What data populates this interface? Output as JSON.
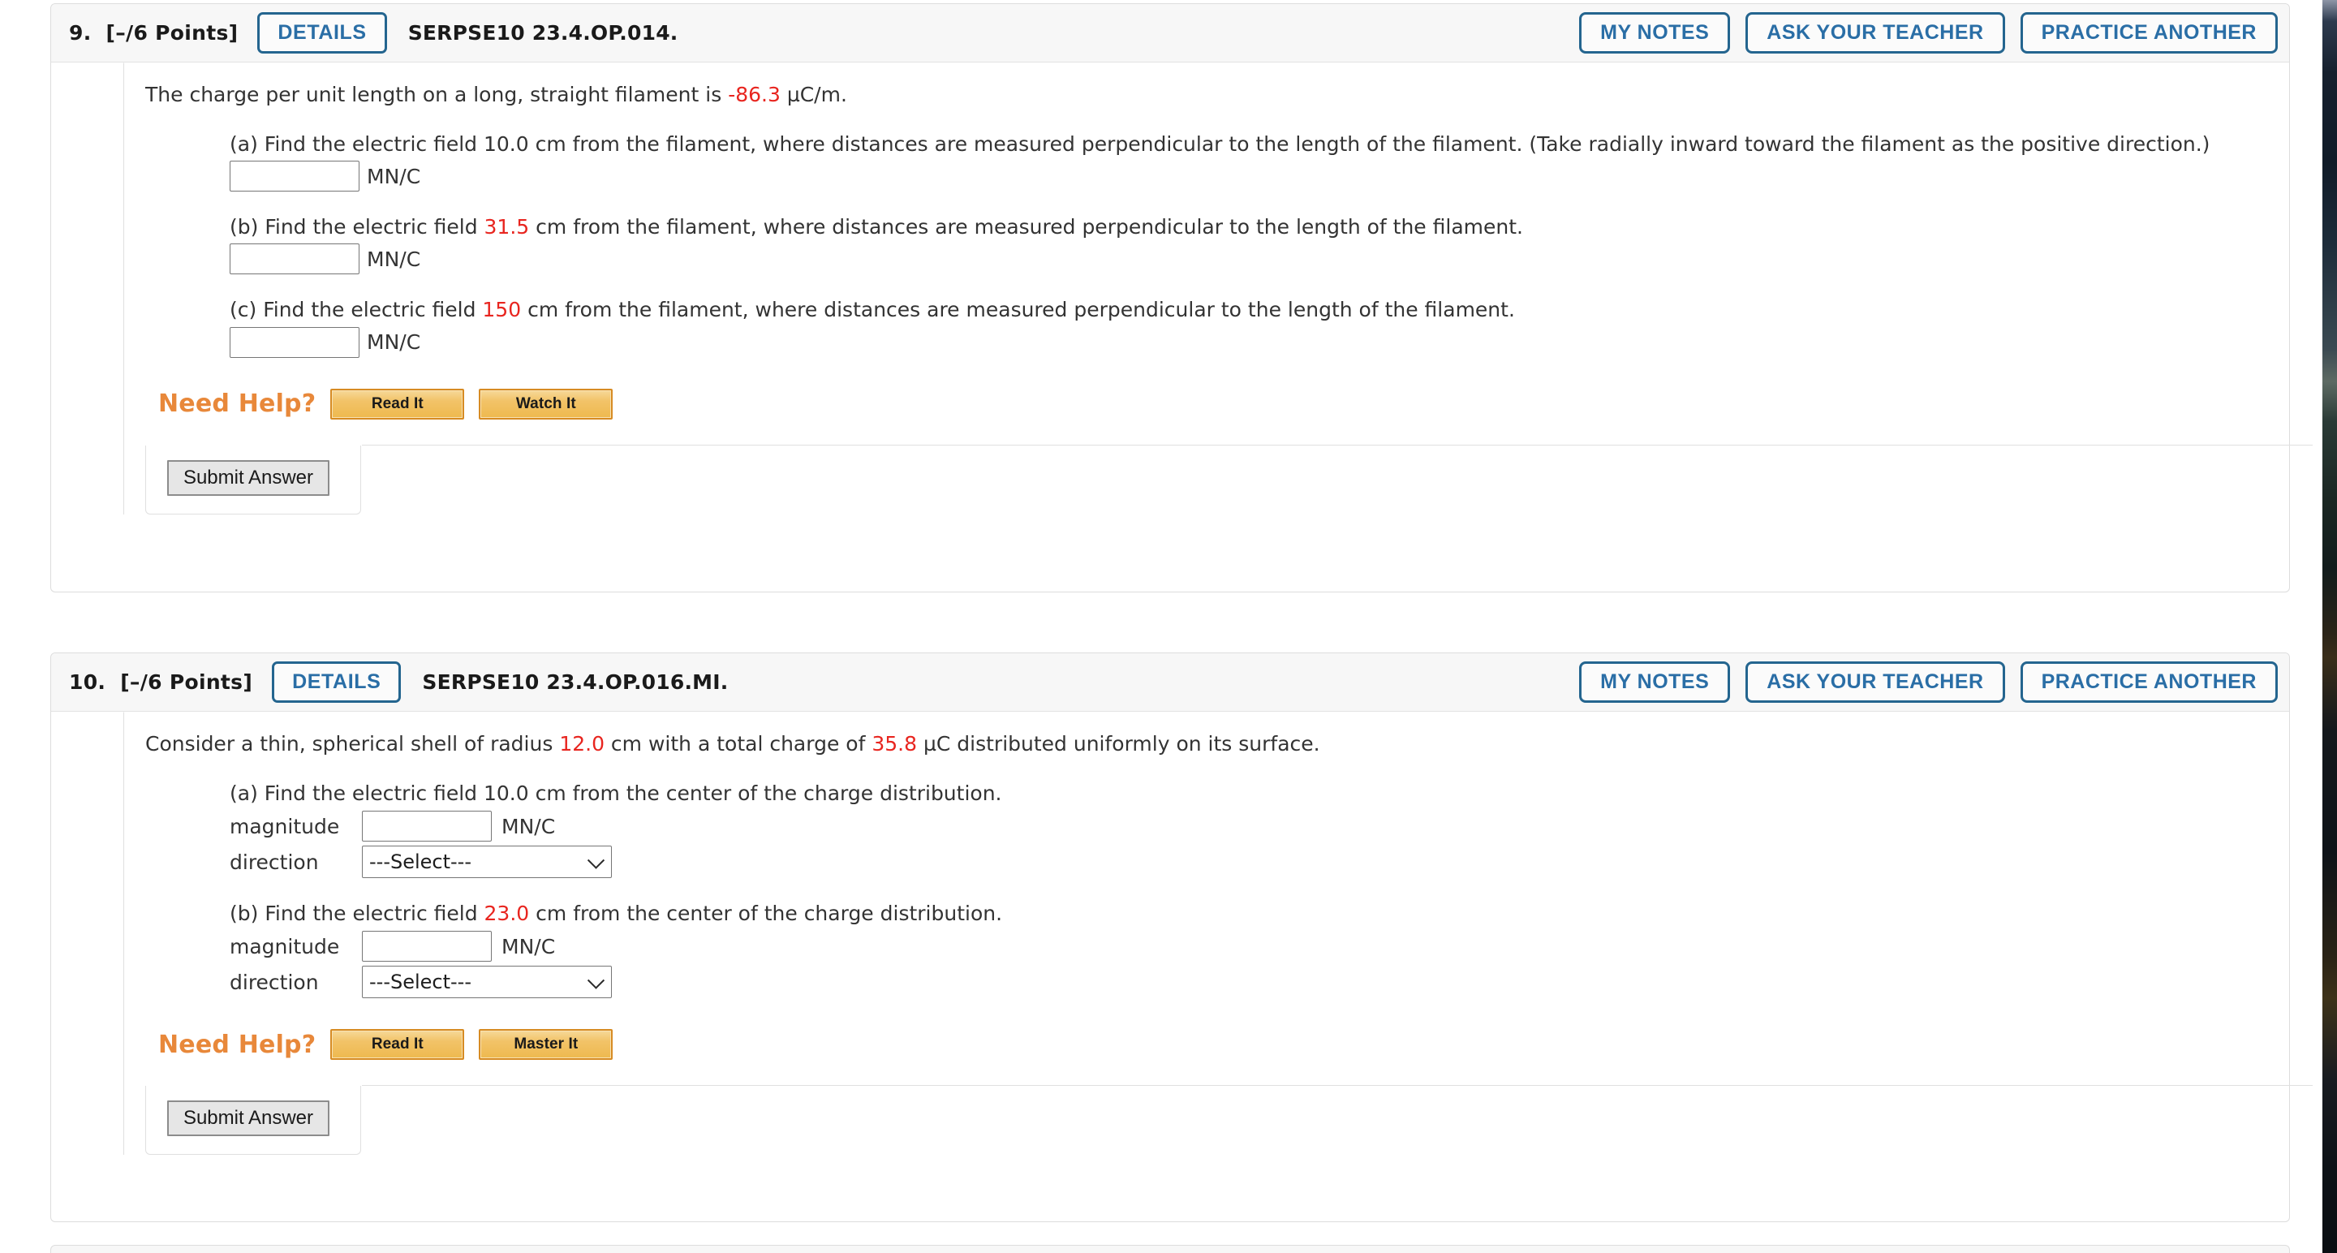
{
  "questions": [
    {
      "number": "9.",
      "points": "[–/6 Points]",
      "details_label": "DETAILS",
      "code": "SERPSE10 23.4.OP.014.",
      "actions": {
        "my_notes": "MY NOTES",
        "ask_your_teacher": "ASK YOUR TEACHER",
        "practice_another": "PRACTICE ANOTHER"
      },
      "stem": {
        "before": "The charge per unit length on a long, straight filament is ",
        "value": "-86.3",
        "after": " µC/m."
      },
      "parts": [
        {
          "label": "(a) Find the electric field 10.0 cm from the filament, where distances are measured perpendicular to the length of the filament. (Take radially inward toward the filament as the positive direction.)",
          "input_value": "",
          "unit": "MN/C"
        },
        {
          "prefix": "(b) Find the electric field ",
          "value": "31.5",
          "suffix": " cm from the filament, where distances are measured perpendicular to the length of the filament.",
          "input_value": "",
          "unit": "MN/C"
        },
        {
          "prefix": "(c) Find the electric field ",
          "value": "150",
          "suffix": " cm from the filament, where distances are measured perpendicular to the length of the filament.",
          "input_value": "",
          "unit": "MN/C"
        }
      ],
      "need_help_label": "Need Help?",
      "help_buttons": [
        "Read It",
        "Watch It"
      ],
      "submit_label": "Submit Answer"
    },
    {
      "number": "10.",
      "points": "[–/6 Points]",
      "details_label": "DETAILS",
      "code": "SERPSE10 23.4.OP.016.MI.",
      "actions": {
        "my_notes": "MY NOTES",
        "ask_your_teacher": "ASK YOUR TEACHER",
        "practice_another": "PRACTICE ANOTHER"
      },
      "stem": {
        "before": "Consider a thin, spherical shell of radius ",
        "value": "12.0",
        "mid": " cm with a total charge of ",
        "value2": "35.8",
        "after": " µC distributed uniformly on its surface."
      },
      "parts": [
        {
          "label": "(a) Find the electric field 10.0 cm from the center of the charge distribution.",
          "magnitude_label": "magnitude",
          "magnitude_value": "",
          "unit": "MN/C",
          "direction_label": "direction",
          "direction_value": "---Select---"
        },
        {
          "prefix": "(b) Find the electric field ",
          "value": "23.0",
          "suffix": " cm from the center of the charge distribution.",
          "magnitude_label": "magnitude",
          "magnitude_value": "",
          "unit": "MN/C",
          "direction_label": "direction",
          "direction_value": "---Select---"
        }
      ],
      "need_help_label": "Need Help?",
      "help_buttons": [
        "Read It",
        "Master It"
      ],
      "submit_label": "Submit Answer"
    }
  ],
  "colors": {
    "accent_blue": "#2a6ea6",
    "value_red": "#e8251f",
    "help_orange": "#e8883a"
  }
}
